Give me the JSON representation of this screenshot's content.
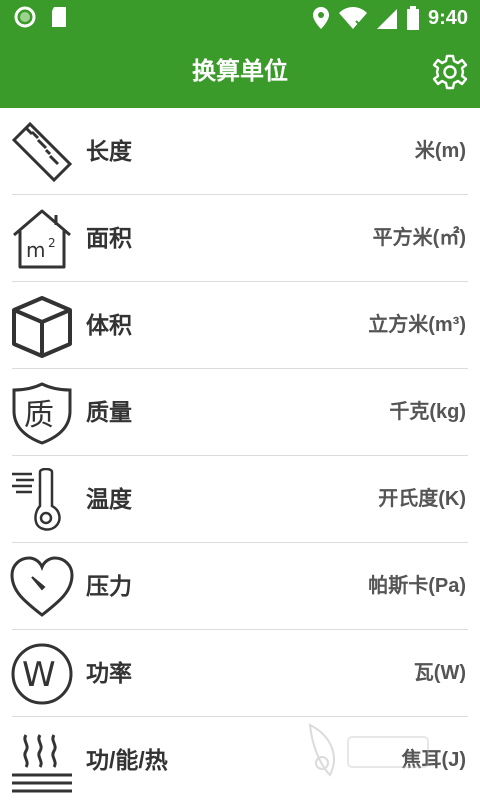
{
  "status_bar": {
    "time": "9:40",
    "icons": [
      "notification-circle-icon",
      "sd-card-icon",
      "location-icon",
      "wifi-icon",
      "signal-icon",
      "battery-icon"
    ]
  },
  "app_bar": {
    "title": "换算单位",
    "settings_icon": "gear-icon"
  },
  "categories": [
    {
      "name": "长度",
      "unit": "米(m)",
      "icon": "ruler-icon"
    },
    {
      "name": "面积",
      "unit": "平方米(㎡)",
      "icon": "house-m2-icon"
    },
    {
      "name": "体积",
      "unit": "立方米(m³)",
      "icon": "cube-icon"
    },
    {
      "name": "质量",
      "unit": "千克(kg)",
      "icon": "shield-mass-icon"
    },
    {
      "name": "温度",
      "unit": "开氏度(K)",
      "icon": "thermometer-icon"
    },
    {
      "name": "压力",
      "unit": "帕斯卡(Pa)",
      "icon": "heart-gauge-icon"
    },
    {
      "name": "功率",
      "unit": "瓦(W)",
      "icon": "circle-w-icon"
    },
    {
      "name": "功/能/热",
      "unit": "焦耳(J)",
      "icon": "heat-waves-icon"
    }
  ],
  "colors": {
    "primary": "#3a9a2a",
    "text": "#333333",
    "unit_text": "#555555",
    "divider": "#dcdcdc"
  }
}
